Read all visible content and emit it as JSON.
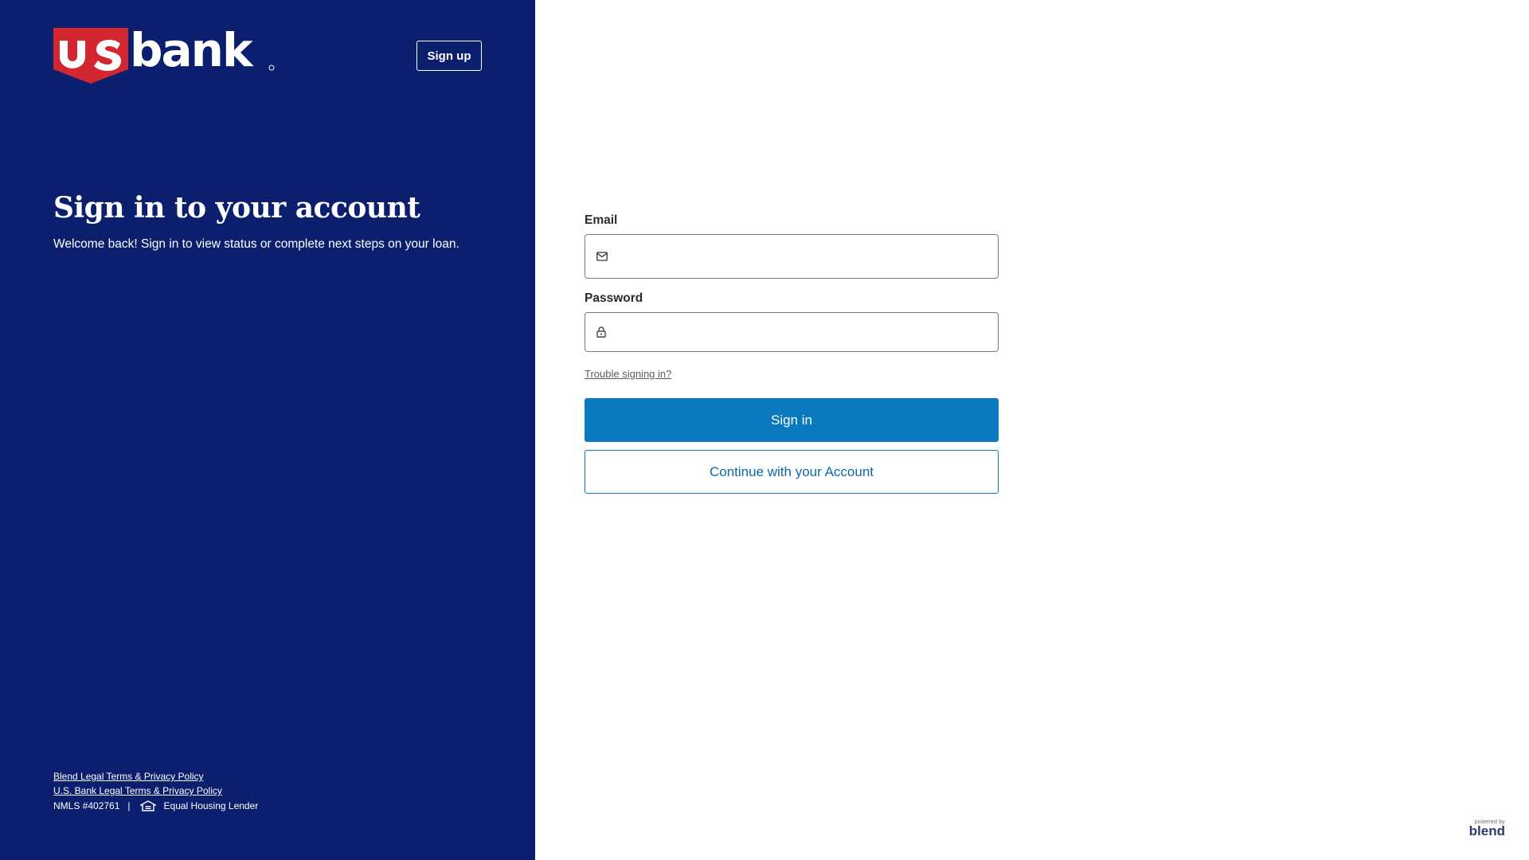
{
  "brand": {
    "logo_alt": "usbank"
  },
  "header": {
    "signup_label": "Sign up"
  },
  "intro": {
    "title": "Sign in to your account",
    "subtitle": "Welcome back! Sign in to view status or complete next steps on your loan."
  },
  "form": {
    "email_label": "Email",
    "email_value": "",
    "password_label": "Password",
    "password_value": "",
    "trouble_link": "Trouble signing in?",
    "signin_label": "Sign in",
    "continue_label": "Continue with your Account"
  },
  "footer": {
    "blend_legal": "Blend Legal Terms & Privacy Policy",
    "usbank_legal": "U.S. Bank Legal Terms & Privacy Policy",
    "nmls": "NMLS #402761",
    "separator": "|",
    "equal_housing": "Equal Housing Lender"
  },
  "powered_by": {
    "small": "powered by",
    "brand": "blend"
  },
  "icons": {
    "email": "mail-icon",
    "password": "lock-icon",
    "housing": "equal-housing-icon"
  },
  "colors": {
    "panel": "#0c1f6e",
    "logo_red": "#d22630",
    "primary": "#0a79bf"
  }
}
